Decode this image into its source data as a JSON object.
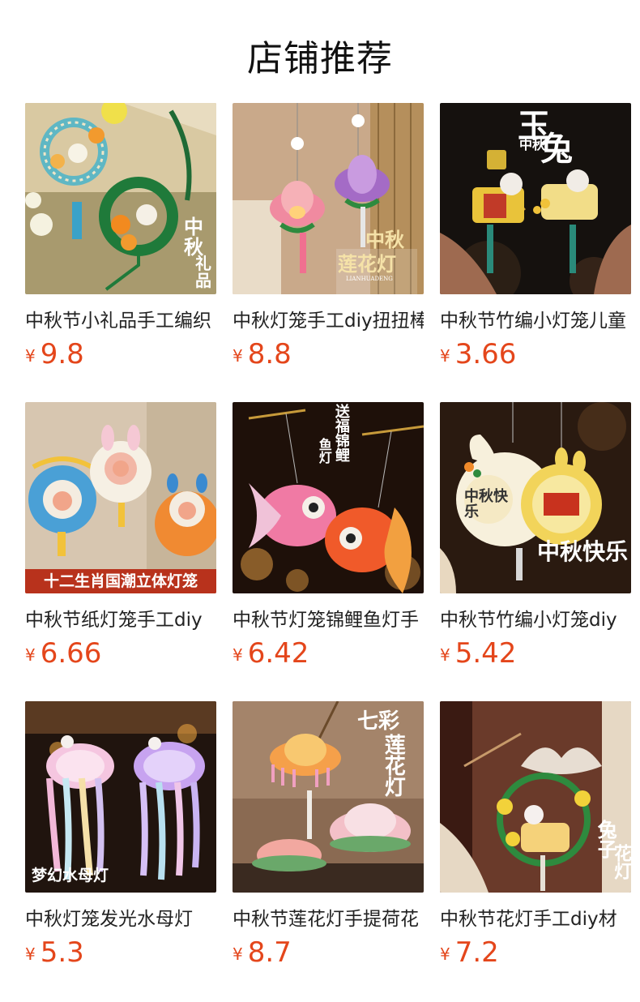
{
  "section": {
    "title": "店铺推荐"
  },
  "currency_symbol": "¥",
  "products": [
    {
      "name": "中秋节小礼品手工编织",
      "price": "9.8",
      "image_text": [
        "中",
        "秋",
        "礼",
        "品"
      ]
    },
    {
      "name": "中秋灯笼手工diy扭扭棒",
      "price": "8.8",
      "image_text": [
        "中秋",
        "莲花灯",
        "LIANHUADENG"
      ]
    },
    {
      "name": "中秋节竹编小灯笼儿童",
      "price": "3.66",
      "image_text": [
        "玉",
        "中秋",
        "兔"
      ]
    },
    {
      "name": "中秋节纸灯笼手工diy",
      "price": "6.66",
      "image_text": [
        "十二生肖国潮立体灯笼"
      ]
    },
    {
      "name": "中秋节灯笼锦鲤鱼灯手",
      "price": "6.42",
      "image_text": [
        "送福锦鲤",
        "鱼灯"
      ]
    },
    {
      "name": "中秋节竹编小灯笼diy",
      "price": "5.42",
      "image_text": [
        "中秋快乐",
        "中秋快乐"
      ]
    },
    {
      "name": "中秋灯笼发光水母灯",
      "price": "5.3",
      "image_text": [
        "梦幻水母灯"
      ]
    },
    {
      "name": "中秋节莲花灯手提荷花",
      "price": "8.7",
      "image_text": [
        "七彩",
        "莲花灯"
      ]
    },
    {
      "name": "中秋节花灯手工diy材",
      "price": "7.2",
      "image_text": [
        "兔子",
        "花灯"
      ]
    }
  ]
}
